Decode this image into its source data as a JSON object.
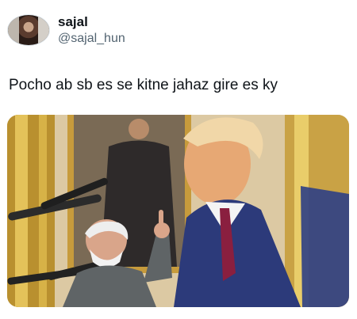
{
  "tweet": {
    "display_name": "sajal",
    "handle": "@sajal_hun",
    "text": "Pocho ab sb es se kitne jahaz gire es ky"
  },
  "media": {
    "description_icon": "photo-icon"
  }
}
